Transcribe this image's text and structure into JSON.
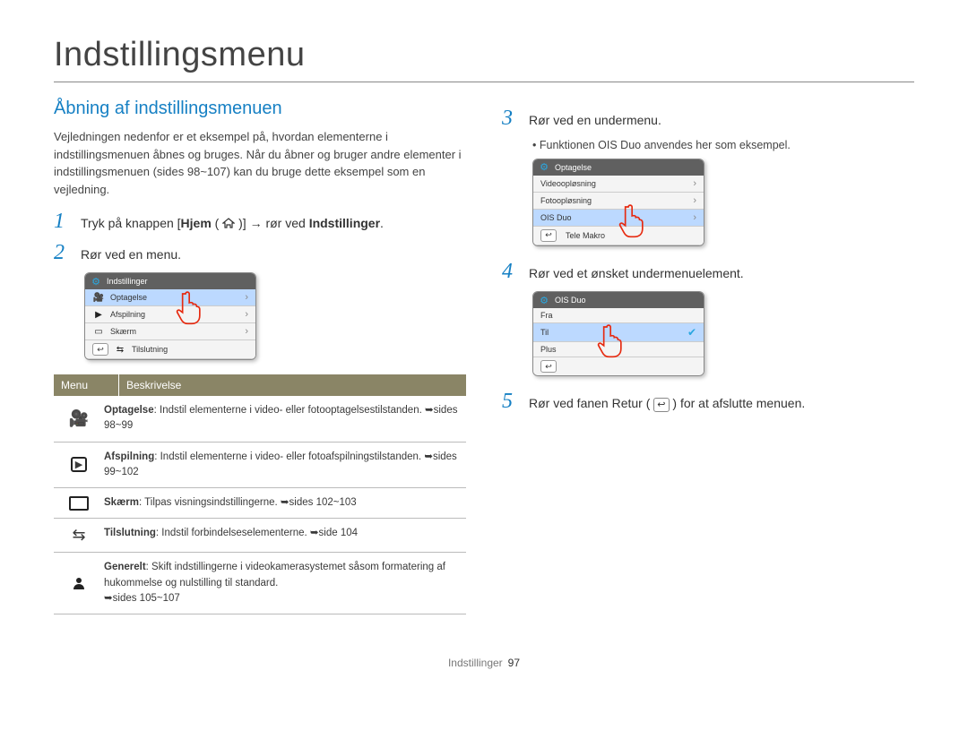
{
  "page": {
    "title": "Indstillingsmenu",
    "footer_label": "Indstillinger",
    "footer_page": "97"
  },
  "left": {
    "heading": "Åbning af indstillingsmenuen",
    "intro": "Vejledningen nedenfor er et eksempel på, hvordan elementerne i indstillingsmenuen åbnes og bruges. Når du åbner og bruger andre elementer i indstillingsmenuen (sides 98~107) kan du bruge dette eksempel som en vejledning.",
    "step1_prefix": "Tryk på knappen [",
    "step1_home_bold": "Hjem",
    "step1_middle": " ( ",
    "step1_after_icon": " )] → rør ved ",
    "step1_settings_bold": "Indstillinger",
    "step1_end": ".",
    "step2": "Rør ved en menu.",
    "ui1_title": "Indstillinger",
    "ui1_items": [
      "Optagelse",
      "Afspilning",
      "Skærm",
      "Tilslutning"
    ],
    "table_head_menu": "Menu",
    "table_head_desc": "Beskrivelse",
    "rows": [
      {
        "icon": "camera-icon",
        "bold": "Optagelse",
        "text": ": Indstil elementerne i video- eller fotooptagelsestilstanden. ",
        "link": "sides 98~99"
      },
      {
        "icon": "play-icon",
        "bold": "Afspilning",
        "text": ": Indstil elementerne i video- eller fotoafspilningstilstanden. ",
        "link": "sides 99~102"
      },
      {
        "icon": "display-icon",
        "bold": "Skærm",
        "text": ": Tilpas visningsindstillingerne. ",
        "link": "sides 102~103"
      },
      {
        "icon": "connection-icon",
        "bold": "Tilslutning",
        "text": ": Indstil forbindelseselementerne. ",
        "link": "side 104"
      },
      {
        "icon": "person-icon",
        "bold": "Generelt",
        "text": ": Skift indstillingerne i videokamerasystemet såsom formatering af hukommelse og nulstilling til standard. ",
        "link": "sides 105~107"
      }
    ]
  },
  "right": {
    "step3": "Rør ved en undermenu.",
    "step3_bullet": "Funktionen OIS Duo anvendes her som eksempel.",
    "ui2_title": "Optagelse",
    "ui2_items": [
      "Videoopløsning",
      "Fotoopløsning",
      "OIS Duo",
      "Tele Makro"
    ],
    "step4": "Rør ved et ønsket undermenuelement.",
    "ui3_title": "OIS Duo",
    "ui3_items": [
      "Fra",
      "Til",
      "Plus"
    ],
    "step5_prefix": "Rør ved fanen Retur ( ",
    "step5_after_icon": " ) for at afslutte menuen."
  }
}
